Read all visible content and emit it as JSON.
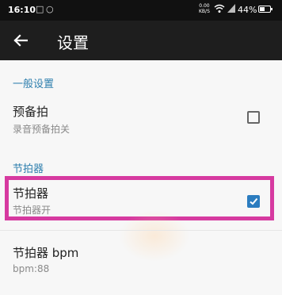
{
  "status_bar": {
    "time": "16:10",
    "speed_value": "0.00",
    "speed_unit": "KB/S",
    "battery": "44%"
  },
  "app_bar": {
    "title": "设置"
  },
  "sections": [
    {
      "header": "一般设置",
      "items": [
        {
          "title": "预备拍",
          "summary": "录音预备拍关",
          "checked": false
        }
      ]
    },
    {
      "header": "节拍器",
      "items": [
        {
          "title": "节拍器",
          "summary": "节拍器开",
          "checked": true
        },
        {
          "title": "节拍器 bpm",
          "summary": "bpm:88"
        }
      ]
    }
  ],
  "colors": {
    "accent": "#2b7cbf",
    "section_header": "#2e7fae",
    "highlight": "#d63aa0",
    "app_bar": "#1e1e1e"
  }
}
